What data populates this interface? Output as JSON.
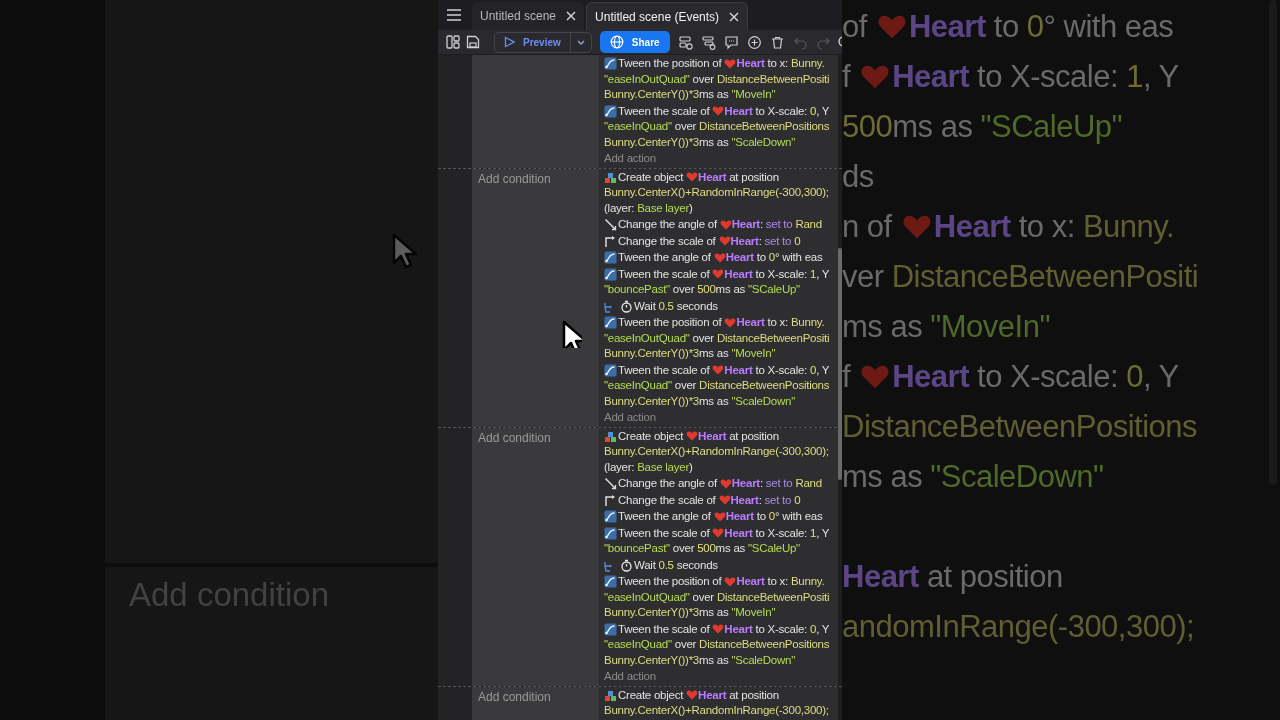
{
  "tabs": [
    {
      "label": "Untitled scene",
      "selected": false
    },
    {
      "label": "Untitled scene (Events)",
      "selected": true
    }
  ],
  "toolbar": {
    "preview": "Preview",
    "share": "Share",
    "tools": [
      {
        "kind": "add-event",
        "disabled": false
      },
      {
        "kind": "add-subevent",
        "disabled": false
      },
      {
        "kind": "comment",
        "disabled": false
      },
      {
        "kind": "add",
        "disabled": false
      },
      {
        "kind": "delete",
        "disabled": false
      },
      {
        "kind": "undo",
        "disabled": true
      },
      {
        "kind": "redo",
        "disabled": true
      },
      {
        "kind": "search",
        "disabled": false
      }
    ]
  },
  "events": [
    {
      "actions": [
        {
          "kind": "tween",
          "lines": [
            [
              {
                "kind": "plain",
                "text": "Tween the position of "
              },
              {
                "kind": "heart"
              },
              {
                "kind": "object",
                "text": "Heart"
              },
              {
                "kind": "plain",
                "text": " to x: "
              },
              {
                "kind": "expression",
                "text": "Bunny."
              }
            ],
            [
              {
                "kind": "string",
                "text": "\"easeInOutQuad\""
              },
              {
                "kind": "plain",
                "text": " over "
              },
              {
                "kind": "expression",
                "text": "DistanceBetweenPositi"
              }
            ],
            [
              {
                "kind": "expression",
                "text": "Bunny.CenterY())*3"
              },
              {
                "kind": "plain",
                "text": "ms as "
              },
              {
                "kind": "string",
                "text": "\"MoveIn\""
              }
            ]
          ]
        },
        {
          "kind": "tween",
          "lines": [
            [
              {
                "kind": "plain",
                "text": "Tween the scale of "
              },
              {
                "kind": "heart"
              },
              {
                "kind": "object",
                "text": "Heart"
              },
              {
                "kind": "plain",
                "text": " to X-scale: "
              },
              {
                "kind": "number",
                "text": "0"
              },
              {
                "kind": "plain",
                "text": ", Y"
              }
            ],
            [
              {
                "kind": "string",
                "text": "\"easeInQuad\""
              },
              {
                "kind": "plain",
                "text": " over "
              },
              {
                "kind": "expression",
                "text": "DistanceBetweenPositions"
              }
            ],
            [
              {
                "kind": "expression",
                "text": "Bunny.CenterY())*3"
              },
              {
                "kind": "plain",
                "text": "ms as "
              },
              {
                "kind": "string",
                "text": "\"ScaleDown\""
              }
            ]
          ]
        }
      ],
      "add_action": "Add action"
    },
    {
      "condition_placeholder": "Add condition",
      "actions": [
        {
          "kind": "create",
          "lines": [
            [
              {
                "kind": "plain",
                "text": "Create object "
              },
              {
                "kind": "heart"
              },
              {
                "kind": "object",
                "text": "Heart"
              },
              {
                "kind": "plain",
                "text": " at position"
              }
            ],
            [
              {
                "kind": "expression",
                "text": "Bunny.CenterX()+RandomInRange(-300,300);"
              }
            ],
            [
              {
                "kind": "plain",
                "text": "(layer: "
              },
              {
                "kind": "string",
                "text": "Base layer"
              },
              {
                "kind": "plain",
                "text": ")"
              }
            ]
          ]
        },
        {
          "kind": "angle",
          "lines": [
            [
              {
                "kind": "plain",
                "text": "Change the angle of "
              },
              {
                "kind": "heart"
              },
              {
                "kind": "object",
                "text": "Heart"
              },
              {
                "kind": "plain",
                "text": ": "
              },
              {
                "kind": "keyword",
                "text": "set to"
              },
              {
                "kind": "expression",
                "text": " Rand"
              }
            ]
          ]
        },
        {
          "kind": "scale",
          "lines": [
            [
              {
                "kind": "plain",
                "text": "Change the scale of "
              },
              {
                "kind": "heart"
              },
              {
                "kind": "object",
                "text": "Heart"
              },
              {
                "kind": "plain",
                "text": ": "
              },
              {
                "kind": "keyword",
                "text": "set to"
              },
              {
                "kind": "number",
                "text": " 0"
              }
            ]
          ]
        },
        {
          "kind": "tween",
          "lines": [
            [
              {
                "kind": "plain",
                "text": "Tween the angle of "
              },
              {
                "kind": "heart"
              },
              {
                "kind": "object",
                "text": "Heart"
              },
              {
                "kind": "plain",
                "text": " to "
              },
              {
                "kind": "number",
                "text": "0"
              },
              {
                "kind": "plain",
                "text": "° with eas"
              }
            ]
          ]
        },
        {
          "kind": "tween",
          "lines": [
            [
              {
                "kind": "plain",
                "text": "Tween the scale of "
              },
              {
                "kind": "heart"
              },
              {
                "kind": "object",
                "text": "Heart"
              },
              {
                "kind": "plain",
                "text": " to X-scale: "
              },
              {
                "kind": "number",
                "text": "1"
              },
              {
                "kind": "plain",
                "text": ", Y"
              }
            ],
            [
              {
                "kind": "string",
                "text": "\"bouncePast\""
              },
              {
                "kind": "plain",
                "text": " over "
              },
              {
                "kind": "number",
                "text": "500"
              },
              {
                "kind": "plain",
                "text": "ms as "
              },
              {
                "kind": "string",
                "text": "\"SCaleUp\""
              }
            ]
          ]
        },
        {
          "kind": "wait",
          "lines": [
            [
              {
                "kind": "plain",
                "text": "Wait "
              },
              {
                "kind": "number",
                "text": "0.5"
              },
              {
                "kind": "plain",
                "text": " seconds"
              }
            ]
          ]
        },
        {
          "kind": "tween",
          "lines": [
            [
              {
                "kind": "plain",
                "text": "Tween the position of "
              },
              {
                "kind": "heart"
              },
              {
                "kind": "object",
                "text": "Heart"
              },
              {
                "kind": "plain",
                "text": " to x: "
              },
              {
                "kind": "expression",
                "text": "Bunny."
              }
            ],
            [
              {
                "kind": "string",
                "text": "\"easeInOutQuad\""
              },
              {
                "kind": "plain",
                "text": " over "
              },
              {
                "kind": "expression",
                "text": "DistanceBetweenPositi"
              }
            ],
            [
              {
                "kind": "expression",
                "text": "Bunny.CenterY())*3"
              },
              {
                "kind": "plain",
                "text": "ms as "
              },
              {
                "kind": "string",
                "text": "\"MoveIn\""
              }
            ]
          ]
        },
        {
          "kind": "tween",
          "lines": [
            [
              {
                "kind": "plain",
                "text": "Tween the scale of "
              },
              {
                "kind": "heart"
              },
              {
                "kind": "object",
                "text": "Heart"
              },
              {
                "kind": "plain",
                "text": " to X-scale: "
              },
              {
                "kind": "number",
                "text": "0"
              },
              {
                "kind": "plain",
                "text": ", Y"
              }
            ],
            [
              {
                "kind": "string",
                "text": "\"easeInQuad\""
              },
              {
                "kind": "plain",
                "text": " over "
              },
              {
                "kind": "expression",
                "text": "DistanceBetweenPositions"
              }
            ],
            [
              {
                "kind": "expression",
                "text": "Bunny.CenterY())*3"
              },
              {
                "kind": "plain",
                "text": "ms as "
              },
              {
                "kind": "string",
                "text": "\"ScaleDown\""
              }
            ]
          ]
        }
      ],
      "add_action": "Add action"
    },
    {
      "condition_placeholder": "Add condition",
      "actions": [
        {
          "kind": "create",
          "lines": [
            [
              {
                "kind": "plain",
                "text": "Create object "
              },
              {
                "kind": "heart"
              },
              {
                "kind": "object",
                "text": "Heart"
              },
              {
                "kind": "plain",
                "text": " at position"
              }
            ],
            [
              {
                "kind": "expression",
                "text": "Bunny.CenterX()+RandomInRange(-300,300);"
              }
            ],
            [
              {
                "kind": "plain",
                "text": "(layer: "
              },
              {
                "kind": "string",
                "text": "Base layer"
              },
              {
                "kind": "plain",
                "text": ")"
              }
            ]
          ]
        },
        {
          "kind": "angle",
          "lines": [
            [
              {
                "kind": "plain",
                "text": "Change the angle of "
              },
              {
                "kind": "heart"
              },
              {
                "kind": "object",
                "text": "Heart"
              },
              {
                "kind": "plain",
                "text": ": "
              },
              {
                "kind": "keyword",
                "text": "set to"
              },
              {
                "kind": "expression",
                "text": " Rand"
              }
            ]
          ]
        },
        {
          "kind": "scale",
          "lines": [
            [
              {
                "kind": "plain",
                "text": "Change the scale of "
              },
              {
                "kind": "heart"
              },
              {
                "kind": "object",
                "text": "Heart"
              },
              {
                "kind": "plain",
                "text": ": "
              },
              {
                "kind": "keyword",
                "text": "set to"
              },
              {
                "kind": "number",
                "text": " 0"
              }
            ]
          ]
        },
        {
          "kind": "tween",
          "lines": [
            [
              {
                "kind": "plain",
                "text": "Tween the angle of "
              },
              {
                "kind": "heart"
              },
              {
                "kind": "object",
                "text": "Heart"
              },
              {
                "kind": "plain",
                "text": " to "
              },
              {
                "kind": "number",
                "text": "0"
              },
              {
                "kind": "plain",
                "text": "° with eas"
              }
            ]
          ]
        },
        {
          "kind": "tween",
          "lines": [
            [
              {
                "kind": "plain",
                "text": "Tween the scale of "
              },
              {
                "kind": "heart"
              },
              {
                "kind": "object",
                "text": "Heart"
              },
              {
                "kind": "plain",
                "text": " to X-scale: "
              },
              {
                "kind": "number",
                "text": "1"
              },
              {
                "kind": "plain",
                "text": ", Y"
              }
            ],
            [
              {
                "kind": "string",
                "text": "\"bouncePast\""
              },
              {
                "kind": "plain",
                "text": " over "
              },
              {
                "kind": "number",
                "text": "500"
              },
              {
                "kind": "plain",
                "text": "ms as "
              },
              {
                "kind": "string",
                "text": "\"SCaleUp\""
              }
            ]
          ]
        },
        {
          "kind": "wait",
          "lines": [
            [
              {
                "kind": "plain",
                "text": "Wait "
              },
              {
                "kind": "number",
                "text": "0.5"
              },
              {
                "kind": "plain",
                "text": " seconds"
              }
            ]
          ]
        },
        {
          "kind": "tween",
          "lines": [
            [
              {
                "kind": "plain",
                "text": "Tween the position of "
              },
              {
                "kind": "heart"
              },
              {
                "kind": "object",
                "text": "Heart"
              },
              {
                "kind": "plain",
                "text": " to x: "
              },
              {
                "kind": "expression",
                "text": "Bunny."
              }
            ],
            [
              {
                "kind": "string",
                "text": "\"easeInOutQuad\""
              },
              {
                "kind": "plain",
                "text": " over "
              },
              {
                "kind": "expression",
                "text": "DistanceBetweenPositi"
              }
            ],
            [
              {
                "kind": "expression",
                "text": "Bunny.CenterY())*3"
              },
              {
                "kind": "plain",
                "text": "ms as "
              },
              {
                "kind": "string",
                "text": "\"MoveIn\""
              }
            ]
          ]
        },
        {
          "kind": "tween",
          "lines": [
            [
              {
                "kind": "plain",
                "text": "Tween the scale of "
              },
              {
                "kind": "heart"
              },
              {
                "kind": "object",
                "text": "Heart"
              },
              {
                "kind": "plain",
                "text": " to X-scale: "
              },
              {
                "kind": "number",
                "text": "0"
              },
              {
                "kind": "plain",
                "text": ", Y"
              }
            ],
            [
              {
                "kind": "string",
                "text": "\"easeInQuad\""
              },
              {
                "kind": "plain",
                "text": " over "
              },
              {
                "kind": "expression",
                "text": "DistanceBetweenPositions"
              }
            ],
            [
              {
                "kind": "expression",
                "text": "Bunny.CenterY())*3"
              },
              {
                "kind": "plain",
                "text": "ms as "
              },
              {
                "kind": "string",
                "text": "\"ScaleDown\""
              }
            ]
          ]
        }
      ],
      "add_action": "Add action"
    },
    {
      "condition_placeholder": "Add condition",
      "actions": [
        {
          "kind": "create",
          "lines": [
            [
              {
                "kind": "plain",
                "text": "Create object "
              },
              {
                "kind": "heart"
              },
              {
                "kind": "object",
                "text": "Heart"
              },
              {
                "kind": "plain",
                "text": " at position"
              }
            ],
            [
              {
                "kind": "expression",
                "text": "Bunny.CenterX()+RandomInRange(-300,300);"
              }
            ]
          ]
        }
      ]
    }
  ],
  "backdrop_left": {
    "text": "Add condition"
  },
  "backdrop_right": {
    "blocks": [
      [
        [
          {
            "kind": "plain",
            "text": "of "
          },
          {
            "kind": "heart"
          },
          {
            "kind": "object",
            "text": "Heart"
          },
          {
            "kind": "plain",
            "text": " to "
          },
          {
            "kind": "number",
            "text": "0"
          },
          {
            "kind": "plain",
            "text": "° with eas"
          }
        ],
        [
          {
            "kind": "plain",
            "text": "f "
          },
          {
            "kind": "heart"
          },
          {
            "kind": "object",
            "text": "Heart"
          },
          {
            "kind": "plain",
            "text": " to X-scale: "
          },
          {
            "kind": "number",
            "text": "1"
          },
          {
            "kind": "plain",
            "text": ", Y"
          }
        ],
        [
          {
            "kind": "number",
            "text": "500"
          },
          {
            "kind": "plain",
            "text": "ms as "
          },
          {
            "kind": "string",
            "text": "\"SCaleUp\""
          }
        ],
        [
          {
            "kind": "plain",
            "text": "ds"
          }
        ],
        [
          {
            "kind": "plain",
            "text": "n of "
          },
          {
            "kind": "heart"
          },
          {
            "kind": "object",
            "text": "Heart"
          },
          {
            "kind": "plain",
            "text": " to x: "
          },
          {
            "kind": "expression",
            "text": "Bunny."
          }
        ],
        [
          {
            "kind": "plain",
            "text": "ver "
          },
          {
            "kind": "expression",
            "text": "DistanceBetweenPositi"
          }
        ],
        [
          {
            "kind": "plain",
            "text": "ms as "
          },
          {
            "kind": "string",
            "text": "\"MoveIn\""
          }
        ],
        [
          {
            "kind": "plain",
            "text": "f "
          },
          {
            "kind": "heart"
          },
          {
            "kind": "object",
            "text": "Heart"
          },
          {
            "kind": "plain",
            "text": " to X-scale: "
          },
          {
            "kind": "number",
            "text": "0"
          },
          {
            "kind": "plain",
            "text": ", Y"
          }
        ],
        [
          {
            "kind": "expression",
            "text": "DistanceBetweenPositions"
          }
        ],
        [
          {
            "kind": "plain",
            "text": "ms as "
          },
          {
            "kind": "string",
            "text": "\"ScaleDown\""
          }
        ]
      ],
      [
        [
          {
            "kind": "object",
            "text": "Heart"
          },
          {
            "kind": "plain",
            "text": " at position"
          }
        ],
        [
          {
            "kind": "expression",
            "text": "andomInRange(-300,300);"
          }
        ]
      ]
    ]
  }
}
